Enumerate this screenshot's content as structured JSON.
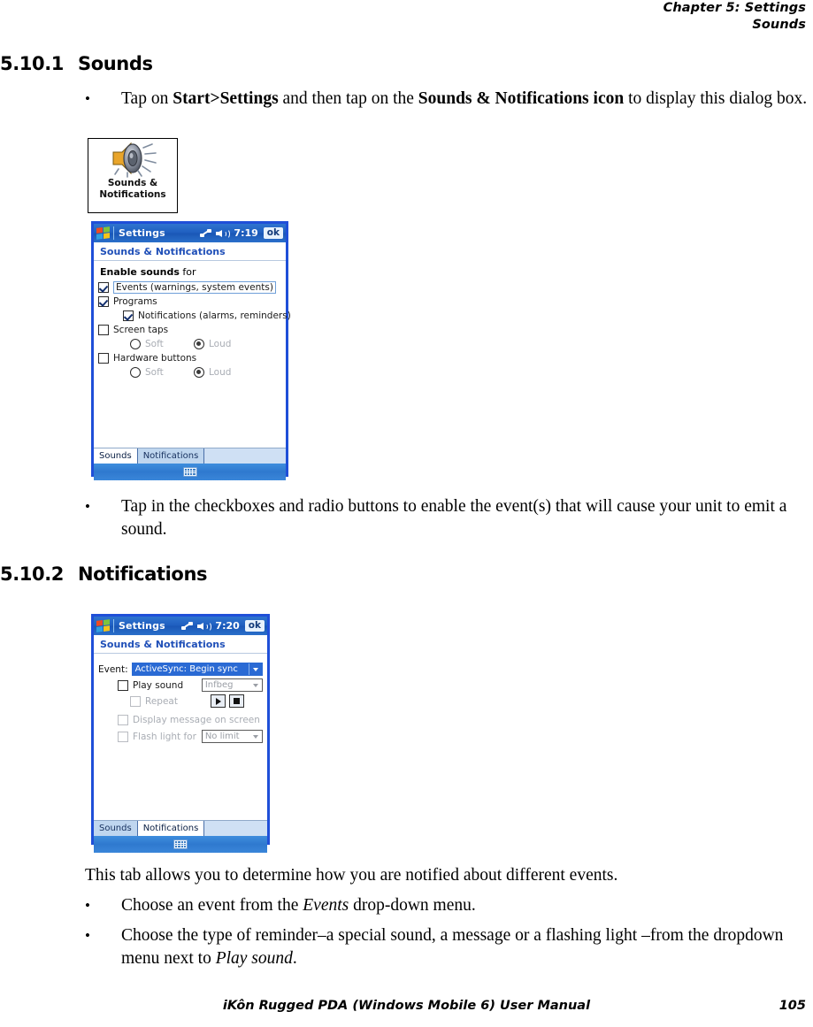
{
  "header": {
    "chapter": "Chapter 5:  Settings",
    "section": "Sounds"
  },
  "sections": [
    {
      "number": "5.10.1",
      "title": "Sounds"
    },
    {
      "number": "5.10.2",
      "title": "Notifications"
    }
  ],
  "body": {
    "bullet_marker": "•",
    "bullet1": {
      "part1": "Tap on ",
      "bold1": "Start>Settings",
      "part2": " and then tap on the ",
      "bold2": "Sounds & Notifications icon",
      "part3": " to display this dialog box."
    },
    "bullet2": "Tap in the checkboxes and radio buttons to enable the event(s) that will cause your unit to emit a sound.",
    "para_tab": "This tab allows you to determine how you are notified about different events.",
    "bullet3": {
      "part1": "Choose an event from the ",
      "italic1": "Events",
      "part2": " drop-down menu."
    },
    "bullet4": {
      "part1": "Choose the type of reminder–a special sound, a message or a flashing light –from the dropdown menu next to ",
      "italic1": "Play sound",
      "part2": "."
    }
  },
  "control_panel_icon": {
    "icon_name": "speaker-sound-icon",
    "label_line1": "Sounds &",
    "label_line2": "Notifications"
  },
  "pda_sounds": {
    "titlebar": {
      "start_icon": "windows-flag-icon",
      "app_title": "Settings",
      "connectivity_icon": "connectivity-icon",
      "volume_icon": "speaker-icon",
      "time": "7:19",
      "ok_label": "ok"
    },
    "subtitle": "Sounds & Notifications",
    "group_label_bold": "Enable sounds",
    "group_label_rest": " for",
    "items": [
      {
        "label": "Events (warnings, system events)",
        "checked": true,
        "indent": 0,
        "focused": true
      },
      {
        "label": "Programs",
        "checked": true,
        "indent": 0,
        "focused": false
      },
      {
        "label": "Notifications (alarms, reminders)",
        "checked": true,
        "indent": 1,
        "focused": false
      },
      {
        "label": "Screen taps",
        "checked": false,
        "indent": 0,
        "focused": false
      },
      {
        "label": "Hardware buttons",
        "checked": false,
        "indent": 0,
        "focused": false
      }
    ],
    "radio_rows": [
      {
        "soft": "Soft",
        "loud": "Loud",
        "selected": "Loud"
      },
      {
        "soft": "Soft",
        "loud": "Loud",
        "selected": "Loud"
      }
    ],
    "tabs": [
      {
        "label": "Sounds",
        "active": true
      },
      {
        "label": "Notifications",
        "active": false
      }
    ],
    "soft_key_icon": "keyboard-icon"
  },
  "pda_notifications": {
    "titlebar": {
      "start_icon": "windows-flag-icon",
      "app_title": "Settings",
      "connectivity_icon": "connectivity-icon",
      "volume_icon": "speaker-icon",
      "time": "7:20",
      "ok_label": "ok"
    },
    "subtitle": "Sounds & Notifications",
    "event_label": "Event:",
    "event_value": "ActiveSync: Begin sync",
    "play_sound_label": "Play sound",
    "play_sound_checked": false,
    "sound_value": "Infbeg",
    "repeat_label": "Repeat",
    "repeat_checked": false,
    "play_button_icon": "play-icon",
    "stop_button_icon": "stop-icon",
    "display_message_label": "Display message on screen",
    "display_message_checked": false,
    "flash_light_label": "Flash light for",
    "flash_light_checked": false,
    "flash_light_value": "No limit",
    "tabs": [
      {
        "label": "Sounds",
        "active": false
      },
      {
        "label": "Notifications",
        "active": true
      }
    ],
    "soft_key_icon": "keyboard-icon"
  },
  "footer": {
    "title": "iKôn Rugged PDA (Windows Mobile 6) User Manual",
    "page": "105"
  },
  "colors": {
    "titlebar_blue": "#2f74cf",
    "frame_blue": "#1f4fd8",
    "subtitle_blue": "#1f4fb8",
    "selection_blue": "#2a6ad4",
    "tab_inactive": "#bfd6ef",
    "disabled_grey": "#a9adb4"
  }
}
